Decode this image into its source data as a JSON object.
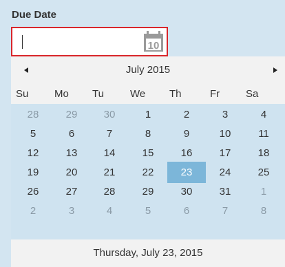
{
  "field": {
    "label": "Due Date",
    "value": "",
    "placeholder": ""
  },
  "calendar_button": {
    "icon": "calendar-icon",
    "icon_text": "10"
  },
  "calendar": {
    "month_title": "July 2015",
    "prev_icon": "triangle-left-icon",
    "next_icon": "triangle-right-icon",
    "weekdays": [
      "Su",
      "Mo",
      "Tu",
      "We",
      "Th",
      "Fr",
      "Sa"
    ],
    "weeks": [
      [
        {
          "d": "28",
          "other": true
        },
        {
          "d": "29",
          "other": true
        },
        {
          "d": "30",
          "other": true
        },
        {
          "d": "1"
        },
        {
          "d": "2"
        },
        {
          "d": "3"
        },
        {
          "d": "4"
        }
      ],
      [
        {
          "d": "5"
        },
        {
          "d": "6"
        },
        {
          "d": "7"
        },
        {
          "d": "8"
        },
        {
          "d": "9"
        },
        {
          "d": "10"
        },
        {
          "d": "11"
        }
      ],
      [
        {
          "d": "12"
        },
        {
          "d": "13"
        },
        {
          "d": "14"
        },
        {
          "d": "15"
        },
        {
          "d": "16"
        },
        {
          "d": "17"
        },
        {
          "d": "18"
        }
      ],
      [
        {
          "d": "19"
        },
        {
          "d": "20"
        },
        {
          "d": "21"
        },
        {
          "d": "22"
        },
        {
          "d": "23",
          "selected": true
        },
        {
          "d": "24"
        },
        {
          "d": "25"
        }
      ],
      [
        {
          "d": "26"
        },
        {
          "d": "27"
        },
        {
          "d": "28"
        },
        {
          "d": "29"
        },
        {
          "d": "30"
        },
        {
          "d": "31"
        },
        {
          "d": "1",
          "other": true
        }
      ],
      [
        {
          "d": "2",
          "other": true
        },
        {
          "d": "3",
          "other": true
        },
        {
          "d": "4",
          "other": true
        },
        {
          "d": "5",
          "other": true
        },
        {
          "d": "6",
          "other": true
        },
        {
          "d": "7",
          "other": true
        },
        {
          "d": "8",
          "other": true
        }
      ]
    ],
    "footer_text": "Thursday, July 23, 2015"
  },
  "colors": {
    "panel_bg": "#d3e5f1",
    "focus_border": "#d9262b",
    "selected_bg": "#7cb6d9",
    "header_bg": "#f2f2f2",
    "other_month_text": "#8a9aa6",
    "icon_gray": "#9a9a9a"
  }
}
